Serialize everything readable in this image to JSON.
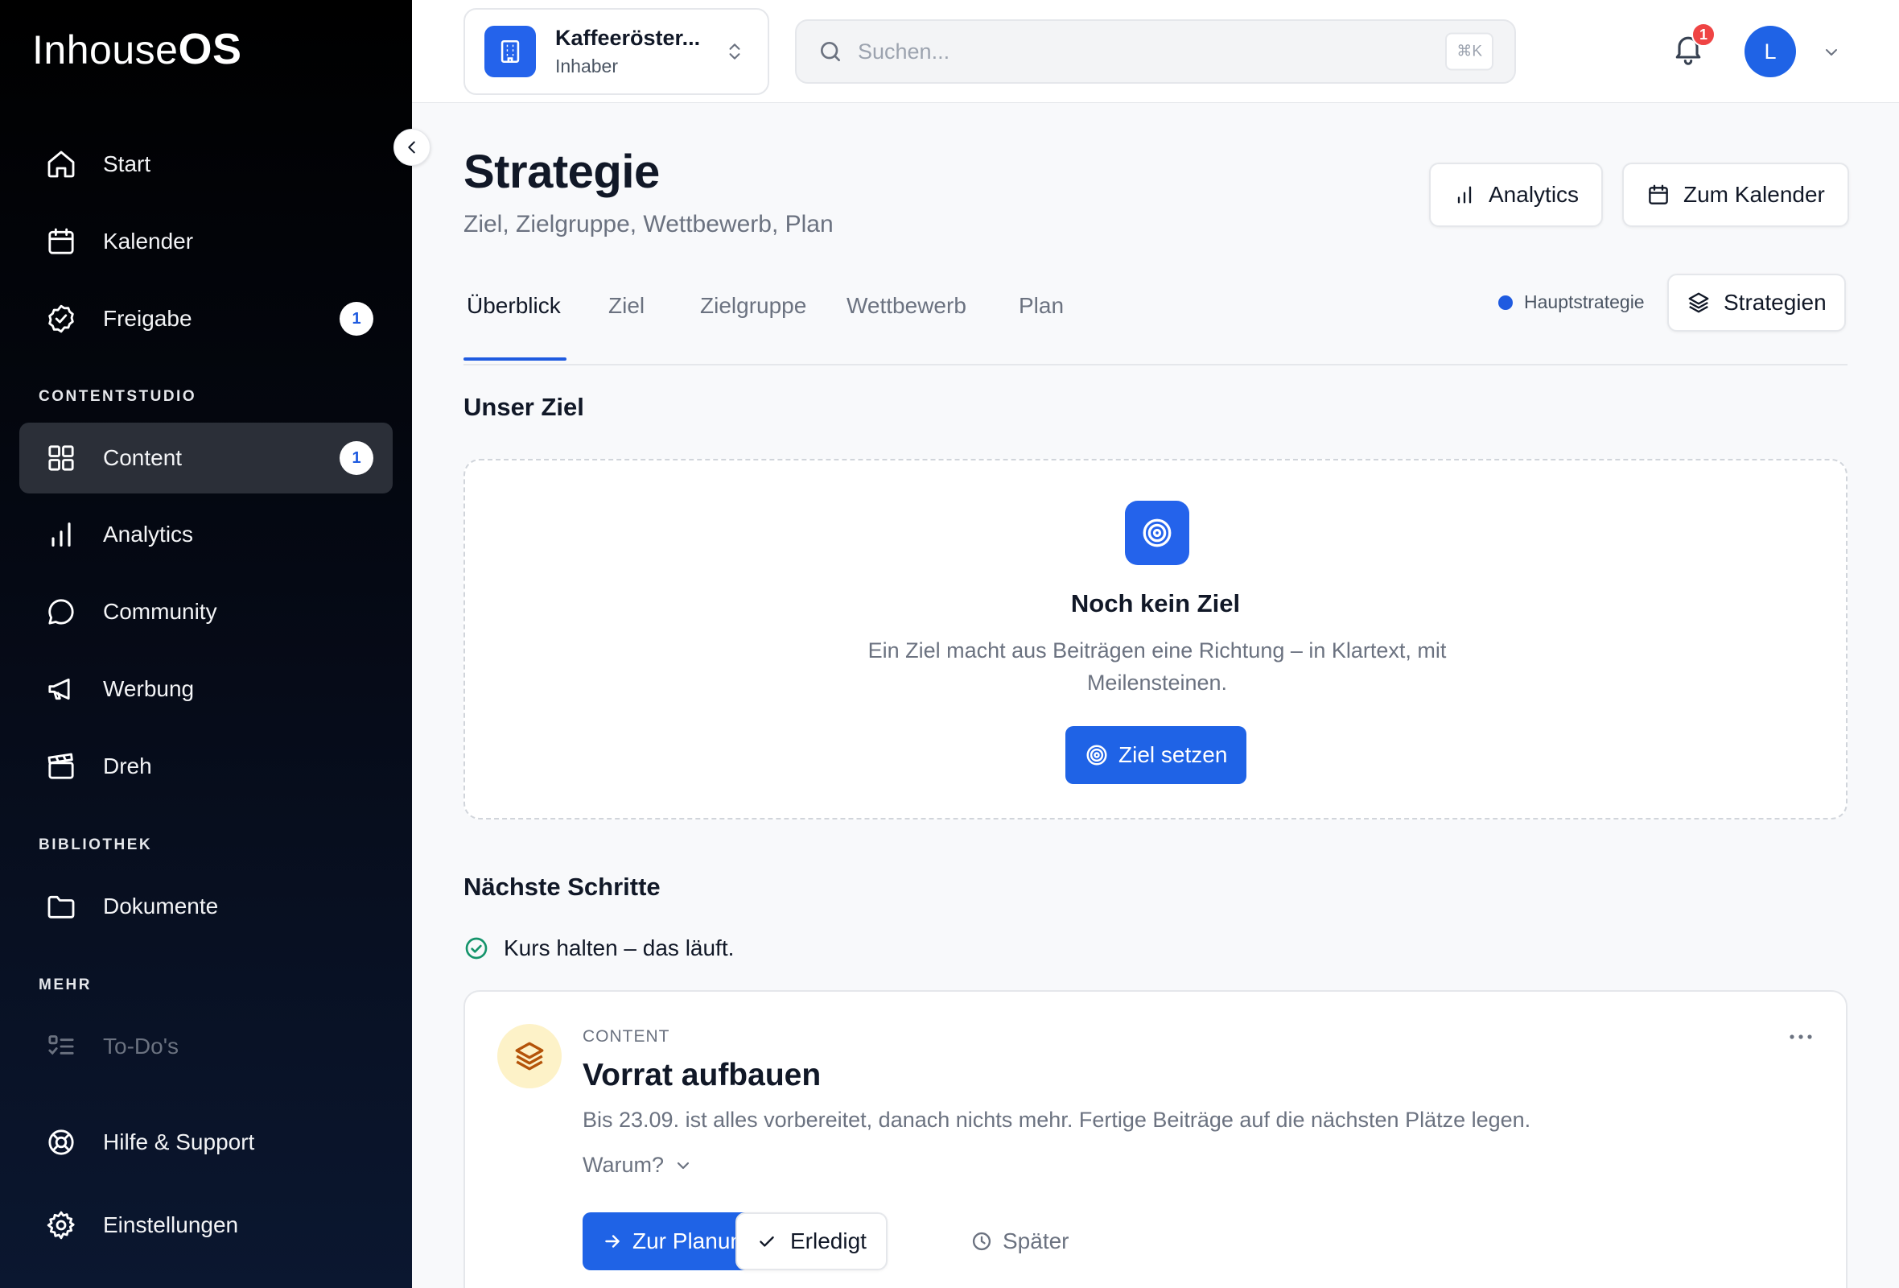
{
  "brand": {
    "logo_thin": "Inhouse",
    "logo_bold": "OS"
  },
  "sidebar": {
    "items_top": [
      {
        "label": "Start",
        "icon": "home-icon"
      },
      {
        "label": "Kalender",
        "icon": "calendar-icon"
      },
      {
        "label": "Freigabe",
        "icon": "check-badge-icon",
        "badge": "1"
      }
    ],
    "section_contentstudio": "CONTENTSTUDIO",
    "items_content": [
      {
        "label": "Content",
        "icon": "grid-icon",
        "badge": "1",
        "active": true
      },
      {
        "label": "Analytics",
        "icon": "bar-chart-icon"
      },
      {
        "label": "Community",
        "icon": "chat-bubble-icon"
      },
      {
        "label": "Werbung",
        "icon": "megaphone-icon"
      },
      {
        "label": "Dreh",
        "icon": "clapperboard-icon"
      }
    ],
    "section_bibliothek": "BIBLIOTHEK",
    "items_library": [
      {
        "label": "Dokumente",
        "icon": "folder-icon"
      }
    ],
    "section_mehr": "MEHR",
    "items_more": [
      {
        "label": "To-Do's",
        "icon": "checklist-icon",
        "disabled": true
      }
    ],
    "items_bottom": [
      {
        "label": "Hilfe & Support",
        "icon": "lifebuoy-icon"
      },
      {
        "label": "Einstellungen",
        "icon": "gear-icon"
      }
    ]
  },
  "header": {
    "org_name": "Kaffeeröster...",
    "org_role": "Inhaber",
    "search_placeholder": "Suchen...",
    "search_shortcut": "⌘K",
    "notification_count": "1",
    "avatar_initial": "L"
  },
  "page": {
    "title": "Strategie",
    "subtitle": "Ziel, Zielgruppe, Wettbewerb, Plan",
    "analytics_button": "Analytics",
    "calendar_button": "Zum Kalender",
    "tabs": [
      "Überblick",
      "Ziel",
      "Zielgruppe",
      "Wettbewerb",
      "Plan"
    ],
    "active_tab": "Überblick",
    "main_strategy_label": "Hauptstrategie",
    "strategies_button": "Strategien"
  },
  "goal": {
    "section_title": "Unser Ziel",
    "empty_title": "Noch kein Ziel",
    "empty_desc": "Ein Ziel macht aus Beiträgen eine Richtung – in Klartext, mit Meilensteinen.",
    "set_button": "Ziel setzen"
  },
  "next_steps": {
    "section_title": "Nächste Schritte",
    "status": "Kurs halten – das läuft.",
    "task": {
      "category": "CONTENT",
      "title": "Vorrat aufbauen",
      "description": "Bis 23.09. ist alles vorbereitet, danach nichts mehr. Fertige Beiträge auf die nächsten Plätze legen.",
      "why_label": "Warum?",
      "primary_button": "Zur Planung",
      "done_button": "Erledigt",
      "later_button": "Später"
    }
  },
  "colors": {
    "accent": "#1f63e6",
    "sidebar_bg": "#000000",
    "badge_red": "#ef4444"
  }
}
